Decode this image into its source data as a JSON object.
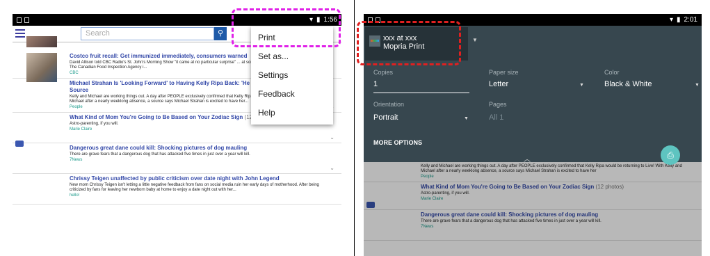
{
  "left": {
    "status": {
      "time": "1:56"
    },
    "search": {
      "placeholder": "Search"
    },
    "menu": {
      "items": [
        "Print",
        "Set as...",
        "Settings",
        "Feedback",
        "Help"
      ]
    },
    "items": [
      {
        "title": "Costco fruit recall: Get immunized immediately, consumers warned",
        "desc": "David Allison told CBC Radio's St. John's Morning Show \"it came at no particular surprise\" ... at some Costco stores was linked to hepatitis A. The Canadian Food Inspection Agency i...",
        "source": "CBC"
      },
      {
        "title": "Michael Strahan Is 'Looking Forward' to Having Kelly Ripa Back: 'He Never W... Happen,' Says Source",
        "desc": "Kelly and Michael are working things out. A day after PEOPLE exclusively confirmed that Kelly Ripa would be returning to Live! With Kelly and Michael after a nearly weeklong absence, a source says Michael Strahan is excited to have her...",
        "source": "People"
      },
      {
        "title": "What Kind of Mom You're Going to Be Based on Your Zodiac Sign",
        "photos": "(12 photos)",
        "desc": "Astro-parenting, if you will.",
        "source": "Marie Claire"
      },
      {
        "title": "Dangerous great dane could kill: Shocking pictures of dog mauling",
        "desc": "There are grave fears that a dangerous dog that has attacked five times in just over a year will kill.",
        "source": "7News"
      },
      {
        "title": "Chrissy Teigen unaffected by public criticism over date night with John Legend",
        "desc": "New mom Chrissy Teigen isn't letting a little negative feedback from fans on social media ruin her early days of motherhood. After being criticized by fans for leaving her newborn baby at home to enjoy a date night out with her...",
        "source": "hello!"
      }
    ]
  },
  "right": {
    "status": {
      "time": "2:01"
    },
    "printer": {
      "line1": "xxx at xxx",
      "line2": "Mopria Print"
    },
    "fields": {
      "copies_label": "Copies",
      "copies_value": "1",
      "paper_label": "Paper size",
      "paper_value": "Letter",
      "color_label": "Color",
      "color_value": "Black & White",
      "orientation_label": "Orientation",
      "orientation_value": "Portrait",
      "pages_label": "Pages",
      "pages_value": "All 1"
    },
    "more_options": "MORE OPTIONS",
    "bg_items": [
      {
        "desc": "Kelly and Michael are working things out. A day after PEOPLE exclusively confirmed that Kelly Ripa would be returning to Live! With Kelly and Michael after a nearly weeklong absence, a source says Michael Strahan is excited to have her",
        "source": "People"
      },
      {
        "title": "What Kind of Mom You're Going to Be Based on Your Zodiac Sign",
        "photos": "(12 photos)",
        "desc": "Astro-parenting, if you will.",
        "source": "Marie Claire"
      },
      {
        "title": "Dangerous great dane could kill: Shocking pictures of dog mauling",
        "desc": "There are grave fears that a dangerous dog that has attacked five times in just over a year will kill.",
        "source": "7News"
      }
    ]
  }
}
